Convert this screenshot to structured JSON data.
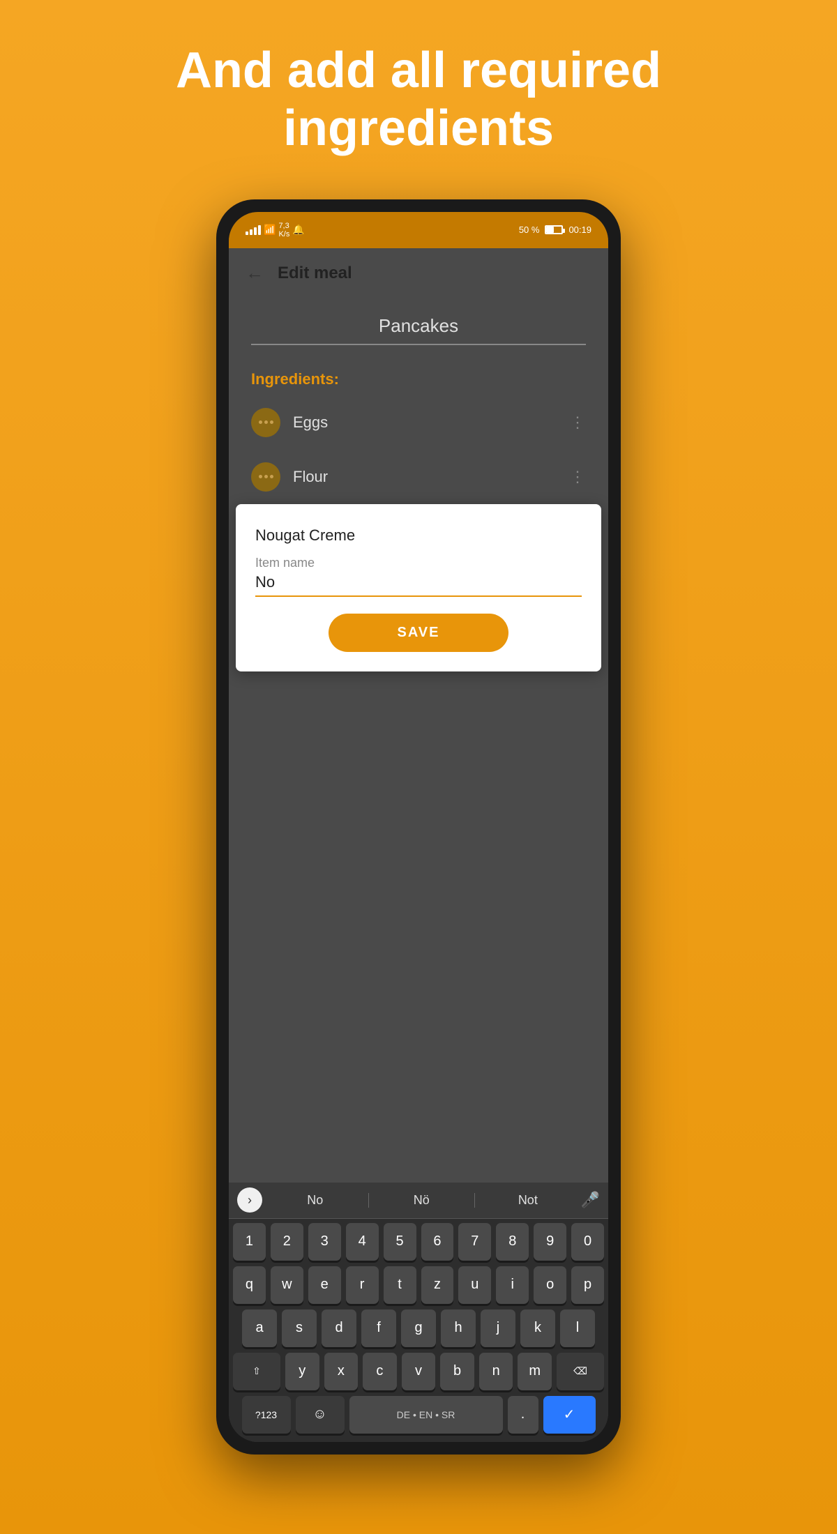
{
  "header": {
    "title": "And add all required ingredients"
  },
  "status_bar": {
    "battery_percent": "50 %",
    "time": "00:19"
  },
  "app_header": {
    "title": "Edit meal",
    "back_label": "←"
  },
  "meal": {
    "name": "Pancakes",
    "name_placeholder": "Pancakes"
  },
  "ingredients": {
    "label": "Ingredients:",
    "items": [
      {
        "name": "Eggs"
      },
      {
        "name": "Flour"
      }
    ]
  },
  "dialog": {
    "autocomplete_suggestion": "Nougat Creme",
    "field_label": "Item name",
    "field_value": "No",
    "save_button": "SAVE"
  },
  "keyboard": {
    "suggestions": [
      "No",
      "Nö",
      "Not"
    ],
    "rows": [
      [
        "1",
        "2",
        "3",
        "4",
        "5",
        "6",
        "7",
        "8",
        "9",
        "0"
      ],
      [
        "q",
        "w",
        "e",
        "r",
        "t",
        "z",
        "u",
        "i",
        "o",
        "p"
      ],
      [
        "a",
        "s",
        "d",
        "f",
        "g",
        "h",
        "j",
        "k",
        "l"
      ],
      [
        "y",
        "x",
        "c",
        "v",
        "b",
        "n",
        "m"
      ],
      [
        "?123",
        ",",
        "😊",
        "DE • EN • SR",
        ".",
        "."
      ]
    ],
    "lang_label": "DE • EN • SR",
    "num_label": "?123"
  }
}
